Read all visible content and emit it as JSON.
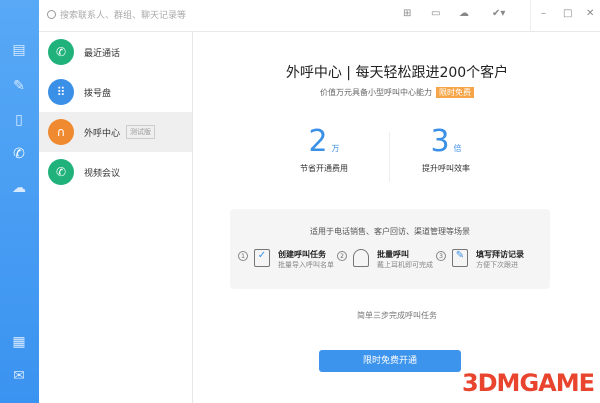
{
  "search": {
    "placeholder": "搜索联系人、群组、聊天记录等"
  },
  "panel": {
    "items": [
      {
        "label": "最近通话",
        "color": "#21b27b"
      },
      {
        "label": "拨号盘",
        "color": "#3a8fe6"
      },
      {
        "label": "外呼中心",
        "color": "#f08a30",
        "badge": "测试版"
      },
      {
        "label": "视频会议",
        "color": "#21b27b"
      }
    ]
  },
  "main": {
    "title": "外呼中心 | 每天轻松跟进200个客户",
    "subtitle": "价值万元具备小型呼叫中心能力",
    "tag": "限时免费",
    "stats": [
      {
        "value": "2",
        "unit": "万",
        "label": "节省开通费用"
      },
      {
        "value": "3",
        "unit": "倍",
        "label": "提升呼叫效率"
      }
    ],
    "scenario": "适用于电话销售、客户回访、渠道管理等场景",
    "steps": [
      {
        "num": "1",
        "title": "创建呼叫任务",
        "desc": "批量导入呼叫名单"
      },
      {
        "num": "2",
        "title": "批量呼叫",
        "desc": "戴上耳机即可完成"
      },
      {
        "num": "3",
        "title": "填写拜访记录",
        "desc": "方便下次跟进"
      }
    ],
    "three_steps": "简单三步完成呼叫任务",
    "button": "限时免费开通"
  },
  "watermark": "3DMGAME"
}
